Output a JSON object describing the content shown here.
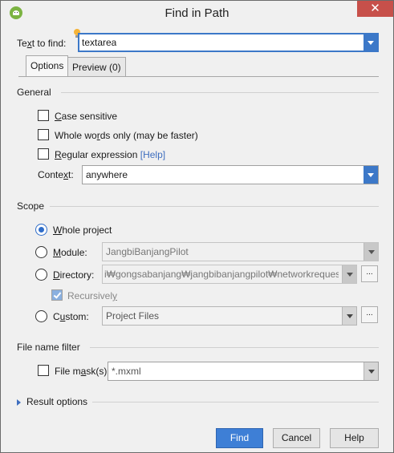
{
  "window": {
    "title": "Find in Path",
    "close_glyph": "✕"
  },
  "find": {
    "label_pre": "Te",
    "label_ul": "x",
    "label_post": "t to find:",
    "value": "textarea"
  },
  "tabs": [
    {
      "label": "Options"
    },
    {
      "label": "Preview (0)"
    }
  ],
  "general": {
    "heading": "General",
    "case_sensitive": {
      "pre": "",
      "ul": "C",
      "post": "ase sensitive",
      "checked": false
    },
    "whole_words": {
      "pre": "Whole wo",
      "ul": "r",
      "post": "ds only (may be faster)",
      "checked": false
    },
    "regex": {
      "pre": "",
      "ul": "R",
      "post": "egular expression",
      "help": "[Help]",
      "checked": false
    },
    "context": {
      "pre": "Conte",
      "ul": "x",
      "post": "t:",
      "value": "anywhere"
    }
  },
  "scope": {
    "heading": "Scope",
    "whole_project": {
      "pre": "",
      "ul": "W",
      "post": "hole project",
      "selected": true
    },
    "module": {
      "pre": "",
      "ul": "M",
      "post": "odule:",
      "value": "JangbiBanjangPilot"
    },
    "directory": {
      "pre": "",
      "ul": "D",
      "post": "irectory:",
      "value": "i₩gongsabanjang₩jangbibanjangpilot₩networkrequest",
      "browse": "..."
    },
    "recursively": {
      "pre": "Recursivel",
      "ul": "y",
      "post": "",
      "checked": true
    },
    "custom": {
      "pre": "C",
      "ul": "u",
      "post": "stom:",
      "value": "Project Files",
      "browse": "..."
    }
  },
  "file_filter": {
    "heading": "File name filter",
    "mask": {
      "pre": "File m",
      "ul": "a",
      "post": "sk(s)",
      "value": "*.mxml",
      "checked": false
    }
  },
  "result_options": {
    "label": "Result options"
  },
  "buttons": {
    "find": "Find",
    "cancel": "Cancel",
    "help": "Help"
  },
  "colors": {
    "accent": "#3c78c8",
    "primary_button": "#3e7fd6",
    "close_button": "#c7504a",
    "link": "#3e6ebf"
  },
  "icons": {
    "app": "android-studio-icon",
    "hint": "lightbulb-icon",
    "dropdown": "chevron-down-icon",
    "expand": "caret-right-icon"
  }
}
